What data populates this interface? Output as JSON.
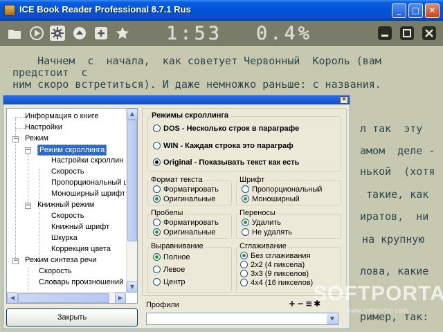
{
  "window": {
    "title": "ICE Book Reader Professional 8.7.1 Rus",
    "buttons": [
      "_",
      "□",
      "✕"
    ]
  },
  "toolbar": {
    "clock": "1:53",
    "percent": "0.4%"
  },
  "reader": {
    "lines": [
      "    Начнем  с  начала,  как советует Червонный  Король (вам",
      "предстоит  с",
      "ним скоро встретиться). И даже немножко раньше: с названия.",
      "л так  эту",
      "амом  деле -",
      "нькой  (хотя",
      " такие, как",
      "иратов,  ни",
      "  на крупную",
      "лова, какие",
      "ример, так:"
    ]
  },
  "dialog": {
    "tree": [
      "Информация о книге",
      "Настройки",
      "Режим",
      "Режим скроллинга",
      "Настройки скроллин",
      "Скорость",
      "Пропорциональный ш",
      "Моноширный шрифт",
      "Книжный режим",
      "Скорость",
      "Книжный шрифт",
      "Шкурка",
      "Коррекция цвета",
      "Режим синтеза речи",
      "Скорость",
      "Словарь произношений"
    ],
    "close_label": "Закрыть",
    "scroll": {
      "title": "Режимы скроллинга",
      "options": [
        "DOS - Несколько строк в параграфе",
        "WIN - Каждая строка это параграф",
        "Original - Показывать текст как есть"
      ],
      "selected": 2
    },
    "groups": [
      {
        "title": "Формат текста",
        "options": [
          "Форматировать",
          "Оригинальные"
        ],
        "selected": 1
      },
      {
        "title": "Шрифт",
        "options": [
          "Пропорциональный",
          "Моноширный"
        ],
        "selected": 1
      },
      {
        "title": "Пробелы",
        "options": [
          "Форматировать",
          "Оригинальные"
        ],
        "selected": 1
      },
      {
        "title": "Переносы",
        "options": [
          "Удалить",
          "Не удалять"
        ],
        "selected": 0
      },
      {
        "title": "Выравнивание",
        "options": [
          "Полное",
          "Левое",
          "Центр"
        ],
        "selected": 0
      },
      {
        "title": "Сглаживание",
        "options": [
          "Без сглаживания",
          "2x2 (4 пиксела)",
          "3x3 (9 пикселов)",
          "4x4 (16 пикселов)"
        ],
        "selected": 0
      }
    ],
    "profiles_label": "Профили",
    "profile_tools": "+−≡✱",
    "watermark": "SOFTPORTAL",
    "watermark_sub": "www.softportal.com"
  }
}
